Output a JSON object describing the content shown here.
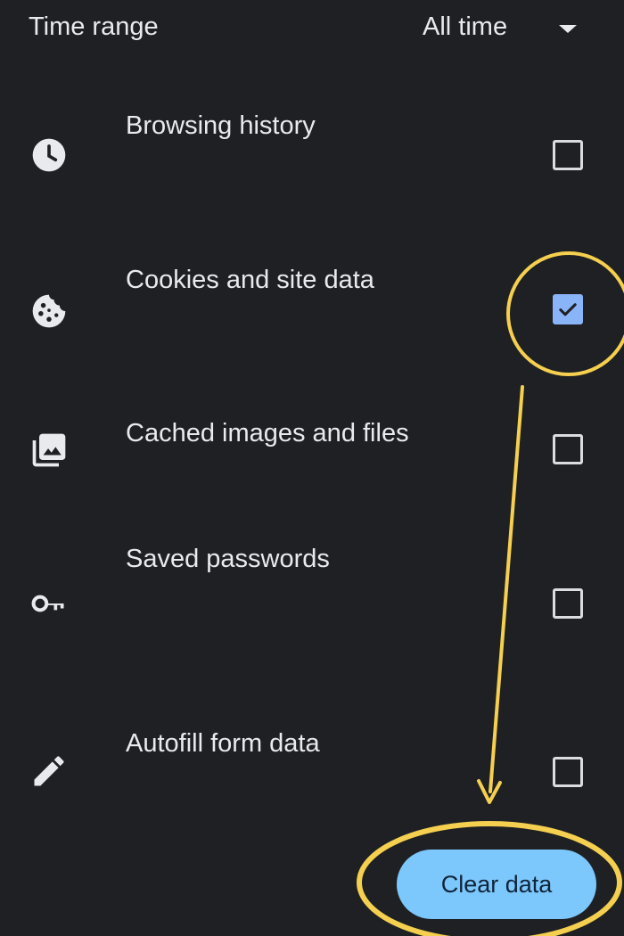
{
  "time_range": {
    "label": "Time range",
    "value": "All time"
  },
  "items": [
    {
      "label": "Browsing history",
      "icon": "clock-icon",
      "checked": false
    },
    {
      "label": "Cookies and site data",
      "icon": "cookie-icon",
      "checked": true
    },
    {
      "label": "Cached images and files",
      "icon": "image-stack-icon",
      "checked": false
    },
    {
      "label": "Saved passwords",
      "icon": "key-icon",
      "checked": false
    },
    {
      "label": "Autofill form data",
      "icon": "pencil-icon",
      "checked": false
    }
  ],
  "clear_button": {
    "label": "Clear data"
  },
  "colors": {
    "background": "#1e2023",
    "checkbox_checked": "#8ab4f8",
    "button": "#7cc7fb",
    "annotation": "#f5cf4f"
  }
}
